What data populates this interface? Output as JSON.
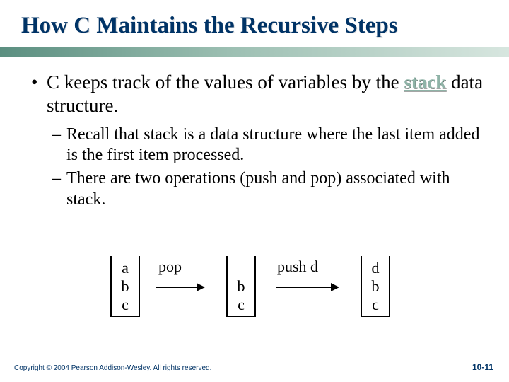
{
  "title": "How C Maintains the Recursive Steps",
  "bullets": {
    "main_pre": "C keeps track of the values of variables by the ",
    "stack_word": "stack",
    "main_post": " data structure.",
    "sub1": "Recall that stack is a data structure where the last item added is the first item processed.",
    "sub2": "There are two operations (push and pop) associated with stack."
  },
  "diagram": {
    "stack1": [
      "a",
      "b",
      "c"
    ],
    "op1": "pop",
    "stack2": [
      "",
      "b",
      "c"
    ],
    "op2": "push d",
    "stack3": [
      "d",
      "b",
      "c"
    ]
  },
  "footer": {
    "copyright": "Copyright © 2004 Pearson Addison-Wesley. All rights reserved.",
    "pagenum": "10-11"
  }
}
